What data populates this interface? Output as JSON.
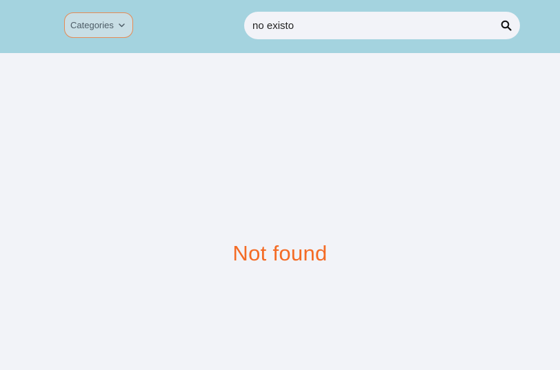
{
  "header": {
    "categories_label": "Categories",
    "categories_icon": "chevron-down-icon",
    "search": {
      "value": "no existo",
      "icon": "search-icon"
    }
  },
  "main": {
    "message": "Not found"
  },
  "colors": {
    "header_bg": "#a4d3df",
    "page_bg": "#f2f3f8",
    "accent": "#f46b25",
    "dropdown_border": "#e58a54"
  }
}
